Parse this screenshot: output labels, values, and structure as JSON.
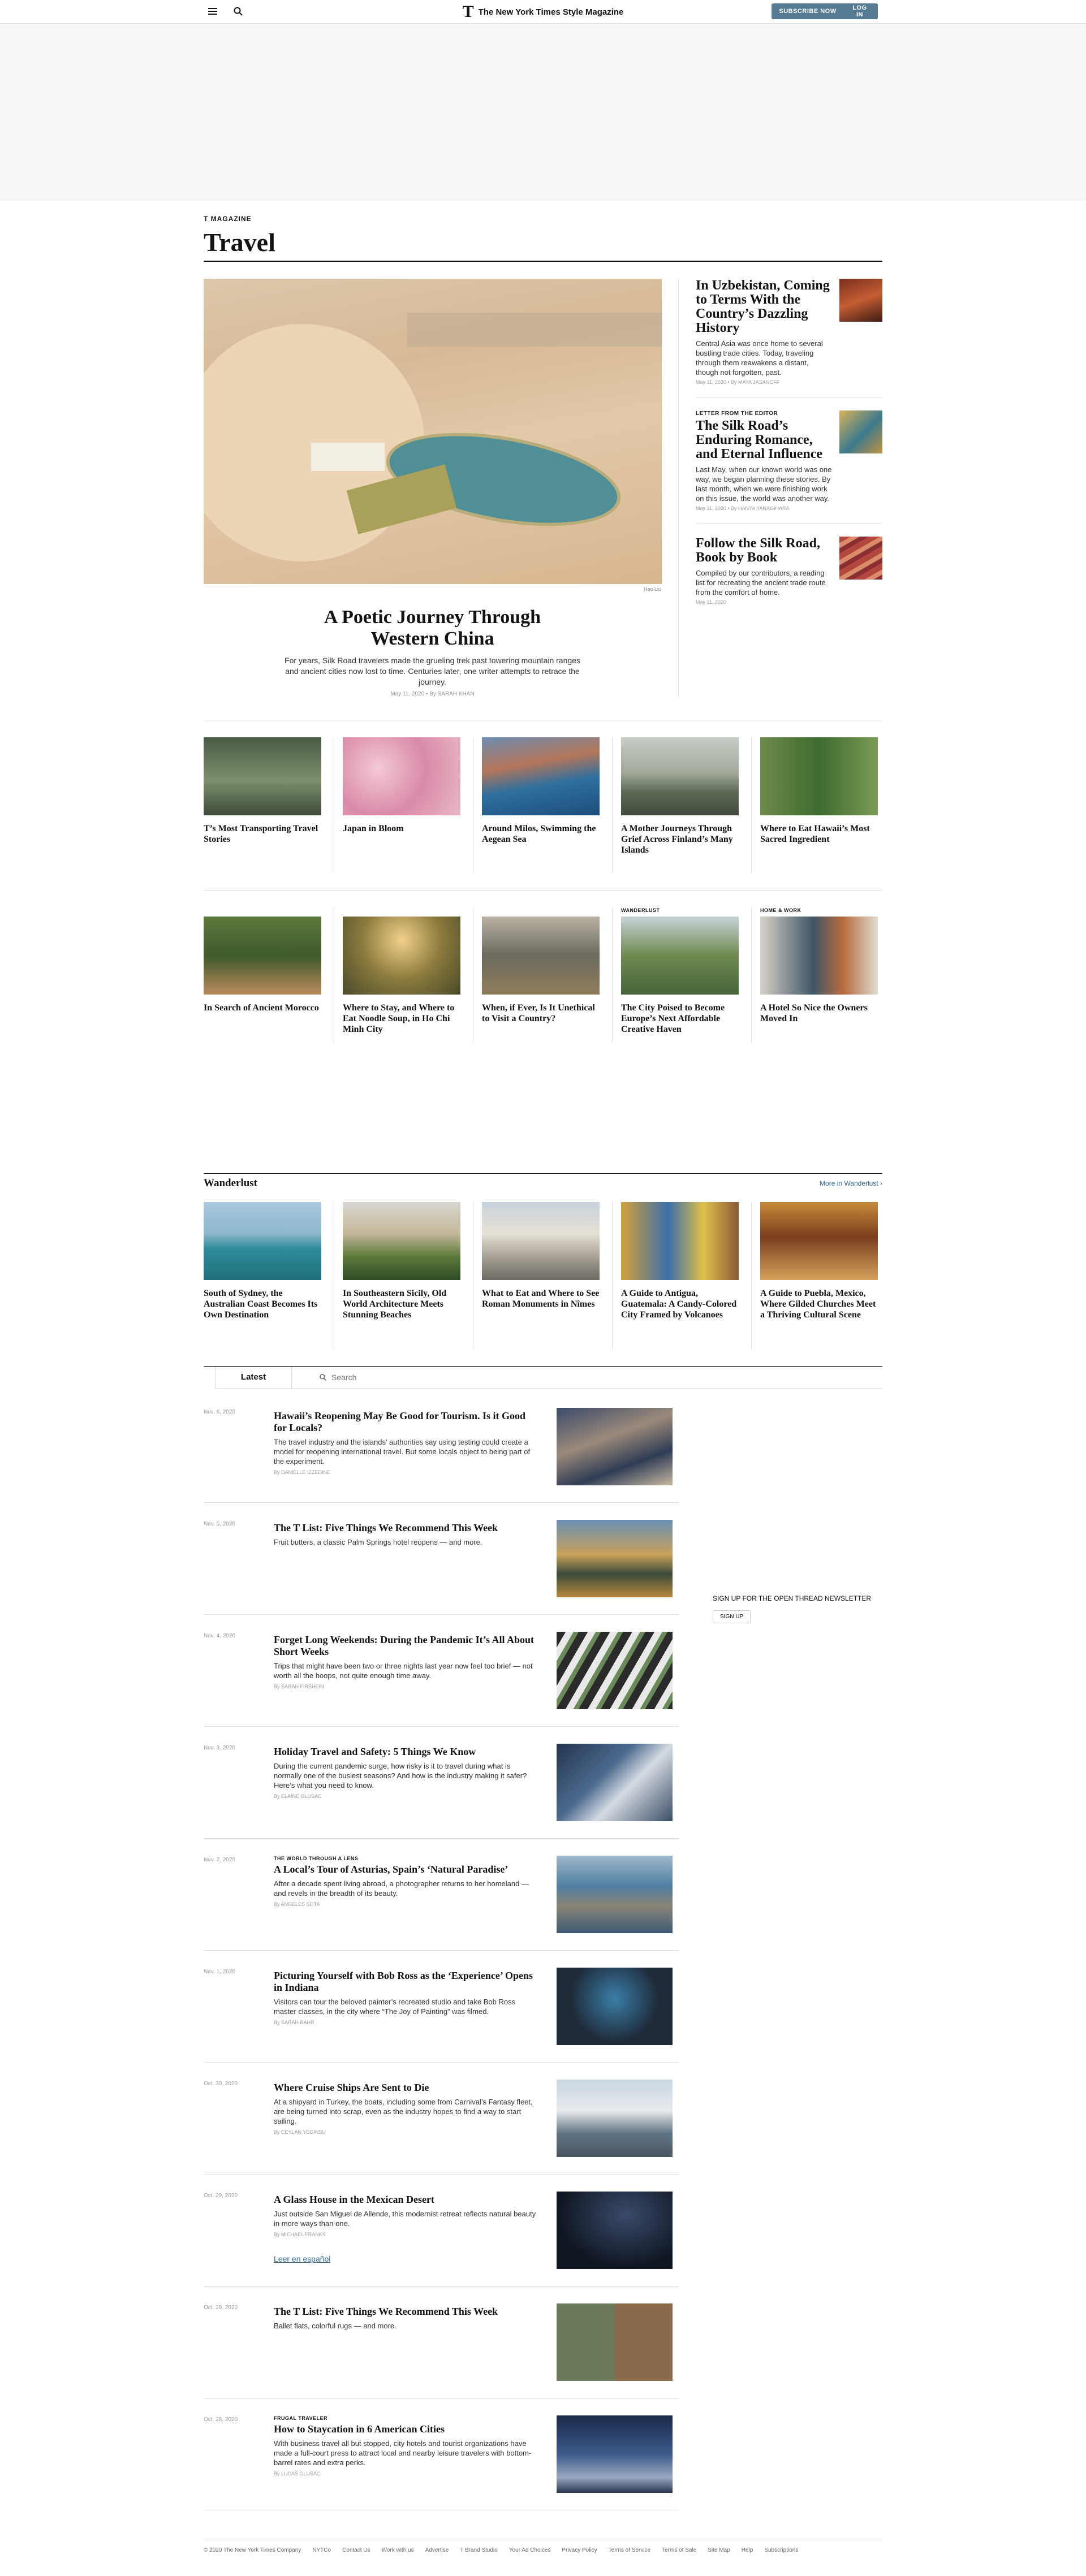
{
  "masthead": {
    "brand_mark": "T",
    "brand_name": "The New York Times Style Magazine",
    "subscribe_label": "SUBSCRIBE NOW",
    "login_label": "LOG IN"
  },
  "section": {
    "kicker": "T MAGAZINE",
    "title": "Travel"
  },
  "lead": {
    "headline": "A Poetic Journey Through Western China",
    "summary": "For years, Silk Road travelers made the grueling trek past towering mountain ranges and ancient cities now lost to time. Centuries later, one writer attempts to retrace the journey.",
    "byline": "May 11, 2020  •  By SARAH KHAN",
    "credit": "Hao Liu"
  },
  "side": [
    {
      "label": "",
      "headline": "In Uzbekistan, Coming to Terms With the Country’s Dazzling History",
      "summary": "Central Asia was once home to several bustling trade cities. Today, traveling through them reawakens a distant, though not forgotten, past.",
      "byline": "May 11, 2020  •  By MAYA JASANOFF"
    },
    {
      "label": "LETTER FROM THE EDITOR",
      "headline": "The Silk Road’s Enduring Romance, and Eternal Influence",
      "summary": "Last May, when our known world was one way, we began planning these stories. By last month, when we were finishing work on this issue, the world was another way.",
      "byline": "May 11, 2020  •  By HANYA YANAGIHARA"
    },
    {
      "label": "",
      "headline": "Follow the Silk Road, Book by Book",
      "summary": "Compiled by our contributors, a reading list for recreating the ancient trade route from the comfort of home.",
      "byline": "May 11, 2020"
    }
  ],
  "row1": [
    {
      "label": "",
      "headline": "T’s Most Transporting Travel Stories"
    },
    {
      "label": "",
      "headline": "Japan in Bloom"
    },
    {
      "label": "",
      "headline": "Around Milos, Swimming the Aegean Sea"
    },
    {
      "label": "",
      "headline": "A Mother Journeys Through Grief Across Finland’s Many Islands"
    },
    {
      "label": "",
      "headline": "Where to Eat Hawaii’s Most Sacred Ingredient"
    }
  ],
  "row2": [
    {
      "label": "",
      "headline": "In Search of Ancient Morocco"
    },
    {
      "label": "",
      "headline": "Where to Stay, and Where to Eat Noodle Soup, in Ho Chi Minh City"
    },
    {
      "label": "",
      "headline": "When, if Ever, Is It Unethical to Visit a Country?"
    },
    {
      "label": "WANDERLUST",
      "headline": "The City Poised to Become Europe’s Next Affordable Creative Haven"
    },
    {
      "label": "HOME & WORK",
      "headline": "A Hotel So Nice the Owners Moved In"
    }
  ],
  "wanderlust": {
    "title": "Wanderlust",
    "more_label": "More in Wanderlust ›",
    "items": [
      {
        "headline": "South of Sydney, the Australian Coast Becomes Its Own Destination"
      },
      {
        "headline": "In Southeastern Sicily, Old World Architecture Meets Stunning Beaches"
      },
      {
        "headline": "What to Eat and Where to See Roman Monuments in Nîmes"
      },
      {
        "headline": "A Guide to Antigua, Guatemala: A Candy-Colored City Framed by Volcanoes"
      },
      {
        "headline": "A Guide to Puebla, Mexico, Where Gilded Churches Meet a Thriving Cultural Scene"
      }
    ]
  },
  "tabs": {
    "latest_label": "Latest",
    "search_placeholder": "Search"
  },
  "stream": [
    {
      "date": "Nov. 6, 2020",
      "label": "",
      "headline": "Hawaii’s Reopening May Be Good for Tourism. Is it Good for Locals?",
      "summary": "The travel industry and the islands’ authorities say using testing could create a model for reopening international travel. But some locals object to being part of the experiment.",
      "byline": "By DANIELLE IZZEDINE",
      "extra": ""
    },
    {
      "date": "Nov. 5, 2020",
      "label": "",
      "headline": "The T List: Five Things We Recommend This Week",
      "summary": "Fruit butters, a classic Palm Springs hotel reopens — and more.",
      "byline": "",
      "extra": ""
    },
    {
      "date": "Nov. 4, 2020",
      "label": "",
      "headline": "Forget Long Weekends: During the Pandemic It’s All About Short Weeks",
      "summary": "Trips that might have been two or three nights last year now feel too brief — not worth all the hoops, not quite enough time away.",
      "byline": "By SARAH FIRSHEIN",
      "extra": ""
    },
    {
      "date": "Nov. 3, 2020",
      "label": "",
      "headline": "Holiday Travel and Safety: 5 Things We Know",
      "summary": "During the current pandemic surge, how risky is it to travel during what is normally one of the busiest seasons? And how is the industry making it safer? Here’s what you need to know.",
      "byline": "By ELAINE GLUSAC",
      "extra": ""
    },
    {
      "date": "Nov. 2, 2020",
      "label": "THE WORLD THROUGH A LENS",
      "headline": "A Local’s Tour of Asturias, Spain’s ‘Natural Paradise’",
      "summary": "After a decade spent living abroad, a photographer returns to her homeland — and revels in the breadth of its beauty.",
      "byline": "By ANGELES SOTA",
      "extra": ""
    },
    {
      "date": "Nov. 1, 2020",
      "label": "",
      "headline": "Picturing Yourself with Bob Ross as the ‘Experience’ Opens in Indiana",
      "summary": "Visitors can tour the beloved painter’s recreated studio and take Bob Ross master classes, in the city where “The Joy of Painting” was filmed.",
      "byline": "By SARAH BAHR",
      "extra": ""
    },
    {
      "date": "Oct. 30, 2020",
      "label": "",
      "headline": "Where Cruise Ships Are Sent to Die",
      "summary": "At a shipyard in Turkey, the boats, including some from Carnival’s Fantasy fleet, are being turned into scrap, even as the industry hopes to find a way to start sailing.",
      "byline": "By CEYLAN YEGINSU",
      "extra": ""
    },
    {
      "date": "Oct. 29, 2020",
      "label": "",
      "headline": "A Glass House in the Mexican Desert",
      "summary": "Just outside San Miguel de Allende, this modernist retreat reflects natural beauty in more ways than one.",
      "byline": "By MICHAEL FRANKS",
      "extra": "Leer en español"
    },
    {
      "date": "Oct. 29, 2020",
      "label": "",
      "headline": "The T List: Five Things We Recommend This Week",
      "summary": "Ballet flats, colorful rugs — and more.",
      "byline": "",
      "extra": ""
    },
    {
      "date": "Oct. 28, 2020",
      "label": "FRUGAL TRAVELER",
      "headline": "How to Staycation in 6 American Cities",
      "summary": "With business travel all but stopped, city hotels and tourist organizations have made a full-court press to attract local and nearby leisure travelers with bottom-barrel rates and extra perks.",
      "byline": "By LUCAS GLUSAC",
      "extra": ""
    }
  ],
  "newsletter": {
    "text": "SIGN UP FOR THE OPEN THREAD NEWSLETTER",
    "button": "SIGN UP"
  },
  "footer": [
    "© 2020 The New York Times Company",
    "NYTCo",
    "Contact Us",
    "Work with us",
    "Advertise",
    "T Brand Studio",
    "Your Ad Choices",
    "Privacy Policy",
    "Terms of Service",
    "Terms of Sale",
    "Site Map",
    "Help",
    "Subscriptions"
  ]
}
